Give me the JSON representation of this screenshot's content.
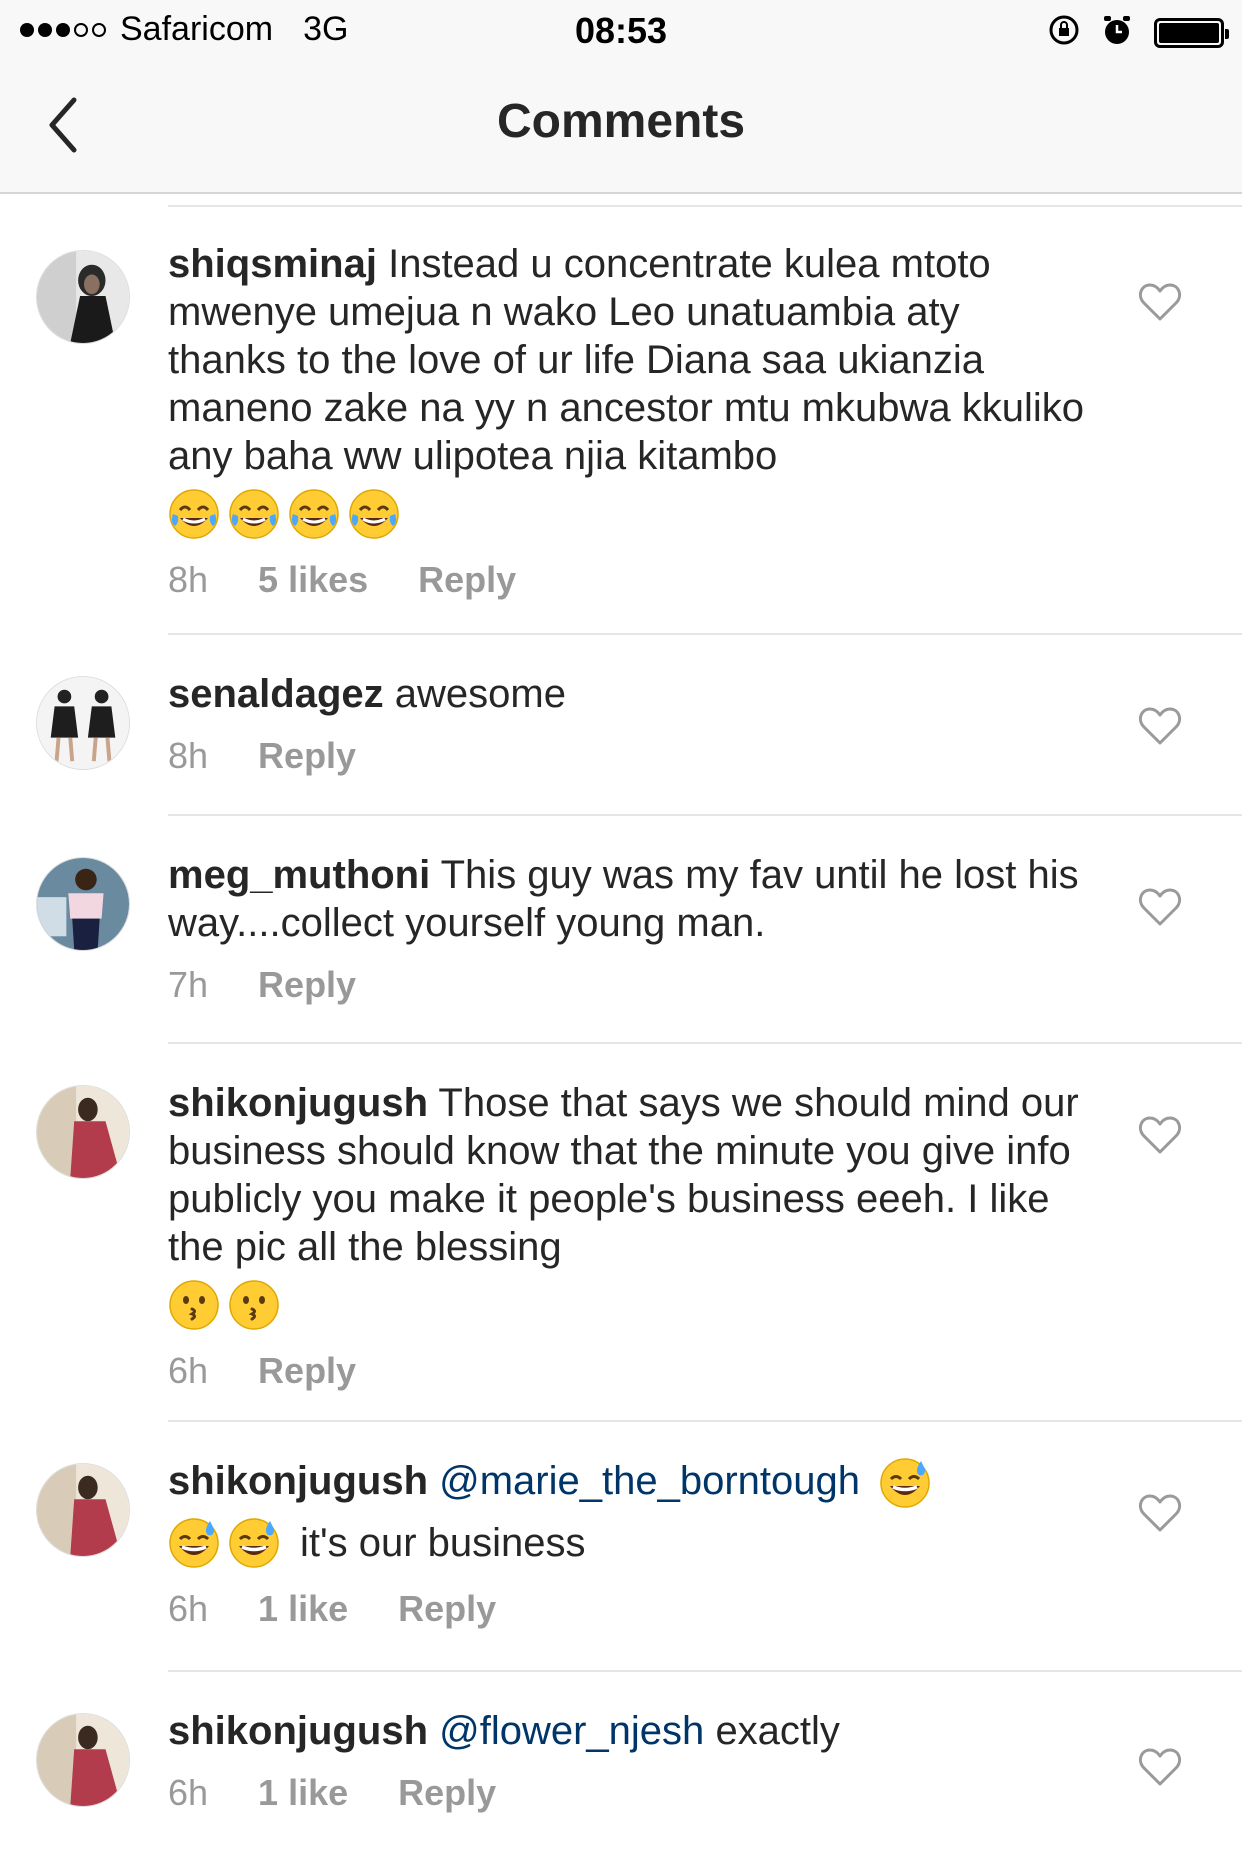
{
  "status": {
    "carrier": "Safaricom",
    "network": "3G",
    "time": "08:53"
  },
  "nav": {
    "title": "Comments"
  },
  "comments": [
    {
      "username": "shiqsminaj",
      "text": "Instead u concentrate kulea mtoto mwenye umejua n wako Leo unatuambia aty thanks to the love of ur life Diana saa ukianzia maneno zake na yy n ancestor mtu mkubwa kkuliko any baha ww ulipotea njia kitambo",
      "emoji": "face-with-tears-of-joy x4",
      "time": "8h",
      "likes": "5 likes",
      "reply": "Reply"
    },
    {
      "username": "senaldagez",
      "text": "awesome",
      "time": "8h",
      "reply": "Reply"
    },
    {
      "username": "meg_muthoni",
      "text": "This guy was my fav until he lost his way....collect yourself young man.",
      "time": "7h",
      "reply": "Reply"
    },
    {
      "username": "shikonjugush",
      "text": "Those that says we should mind our business should know that the minute you give info publicly you make it people's business eeeh. I like the pic all the blessing",
      "emoji": "kissing-face x2",
      "time": "6h",
      "reply": "Reply"
    },
    {
      "username": "shikonjugush",
      "mention": "@marie_the_borntough",
      "text": "it's our business",
      "emoji": "grinning-sweat-face x3",
      "time": "6h",
      "likes": "1 like",
      "reply": "Reply"
    },
    {
      "username": "shikonjugush",
      "mention": "@flower_njesh",
      "text": "exactly",
      "time": "6h",
      "likes": "1 like",
      "reply": "Reply"
    }
  ],
  "colors": {
    "text": "#262626",
    "meta": "#999999",
    "mention": "#003569",
    "separator": "#e6e6e6",
    "bar": "#f8f8f8"
  }
}
